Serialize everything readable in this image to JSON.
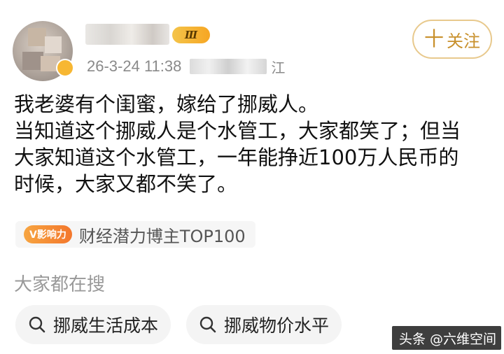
{
  "header": {
    "level_badge": "Ⅲ",
    "timestamp": "26-3-24 11:38",
    "location_tail": "江",
    "follow_label": "关注",
    "follow_plus": "十"
  },
  "post": {
    "lines": [
      "我老婆有个闺蜜，嫁给了挪威人。",
      "当知道这个挪威人是个水管工，大家都笑了；但当",
      "大家知道这个水管工，一年能挣近100万人民币的",
      "时候，大家又都不笑了。"
    ]
  },
  "influence": {
    "badge": "V影响力",
    "text": "财经潜力博主TOP100"
  },
  "search": {
    "heading": "大家都在搜",
    "queries": [
      "挪威生活成本",
      "挪威物价水平"
    ]
  },
  "watermark": {
    "text": "头条 @六维空间"
  },
  "colors": {
    "accent": "#c8902c",
    "follow_border": "#e8c98d",
    "influence_badge": "#f3772c",
    "muted_text": "#999999"
  },
  "icons": {
    "search": "search-icon",
    "plus": "plus-icon",
    "level": "level-badge-icon"
  }
}
